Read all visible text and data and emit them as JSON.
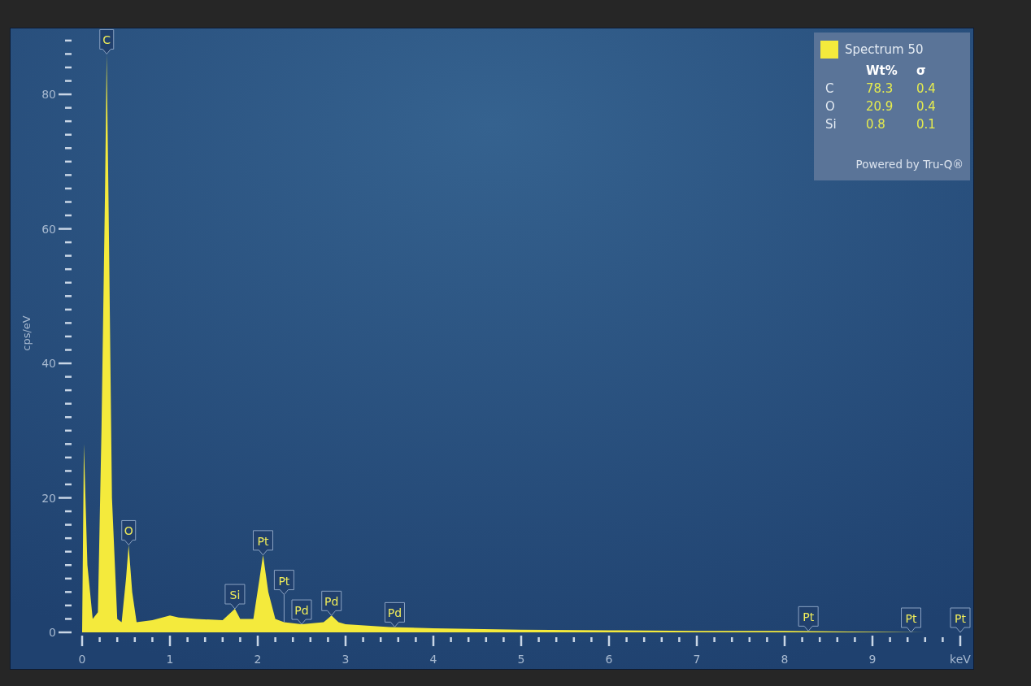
{
  "chart": {
    "chart_data": {
      "type": "area",
      "ylabel": "cps/eV",
      "x": [
        0,
        0.02,
        0.06,
        0.12,
        0.18,
        0.22,
        0.26,
        0.28,
        0.3,
        0.34,
        0.4,
        0.45,
        0.5,
        0.53,
        0.57,
        0.62,
        0.8,
        1.0,
        1.1,
        1.3,
        1.6,
        1.74,
        1.8,
        1.95,
        2.02,
        2.06,
        2.12,
        2.2,
        2.3,
        2.5,
        2.75,
        2.84,
        2.92,
        3.0,
        3.5,
        4,
        5,
        6,
        7,
        8,
        9,
        9.6,
        10
      ],
      "series": [
        {
          "name": "Spectrum 50",
          "color": "#f4ea3c",
          "values": [
            0,
            28,
            10,
            2,
            3,
            30,
            65,
            86,
            65,
            20,
            2,
            1.5,
            8,
            13,
            6,
            1.5,
            1.8,
            2.5,
            2.2,
            2,
            1.8,
            3.5,
            2,
            2,
            8,
            11.5,
            6,
            2,
            1.5,
            1.2,
            1.5,
            2.5,
            1.5,
            1.2,
            0.8,
            0.6,
            0.4,
            0.3,
            0.2,
            0.2,
            0.1,
            0,
            0
          ]
        }
      ],
      "xlim": [
        0,
        10
      ],
      "ylim": [
        0,
        89.8
      ],
      "xticks": [
        0,
        1,
        2,
        3,
        4,
        5,
        6,
        7,
        8,
        9,
        {
          "value": 10,
          "label": "keV"
        }
      ],
      "yticks": [
        0,
        20,
        40,
        60,
        80
      ],
      "annotations": [
        {
          "x": 0.28,
          "y": 86,
          "text": "C"
        },
        {
          "x": 0.53,
          "y": 13,
          "text": "O"
        },
        {
          "x": 1.74,
          "y": 3.5,
          "text": "Si"
        },
        {
          "x": 2.06,
          "y": 11.5,
          "text": "Pt"
        },
        {
          "x": 2.3,
          "y": 1.5,
          "text": "Pt"
        },
        {
          "x": 2.5,
          "y": 1.2,
          "text": "Pd"
        },
        {
          "x": 2.84,
          "y": 2.5,
          "text": "Pd"
        },
        {
          "x": 3.56,
          "y": 0.8,
          "text": "Pd"
        },
        {
          "x": 8.27,
          "y": 0.2,
          "text": "Pt"
        },
        {
          "x": 9.44,
          "y": 0,
          "text": "Pt"
        },
        {
          "x": 10,
          "y": 0,
          "text": "Pt"
        }
      ]
    }
  },
  "legend": {
    "columns": [
      "Wt%",
      "σ"
    ],
    "rows": [
      {
        "element": "C",
        "wt": "78.3",
        "sigma": "0.4"
      },
      {
        "element": "O",
        "wt": "20.9",
        "sigma": "0.4"
      },
      {
        "element": "Si",
        "wt": "0.8",
        "sigma": "0.1"
      }
    ],
    "footer": "Powered by Tru-Q®"
  }
}
